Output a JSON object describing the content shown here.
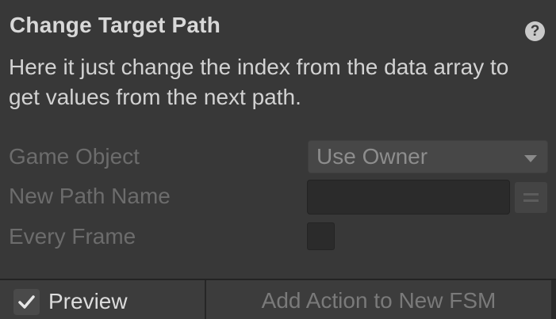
{
  "action": {
    "title": "Change Target Path",
    "help_icon": "question-mark-icon",
    "description": "Here it just change the index from the data array to get values from the next path."
  },
  "fields": [
    {
      "label": "Game Object",
      "control": "dropdown",
      "value": "Use Owner"
    },
    {
      "label": "New Path Name",
      "control": "text-input",
      "value": ""
    },
    {
      "label": "Every Frame",
      "control": "checkbox",
      "checked": false
    }
  ],
  "footer": {
    "preview_label": "Preview",
    "preview_checked": true,
    "add_action_label": "Add Action to New FSM"
  },
  "colors": {
    "background": "#383838",
    "title_text": "#d8d8d8",
    "disabled_label": "#6c6c6c",
    "input_background": "#2b2b2b"
  }
}
